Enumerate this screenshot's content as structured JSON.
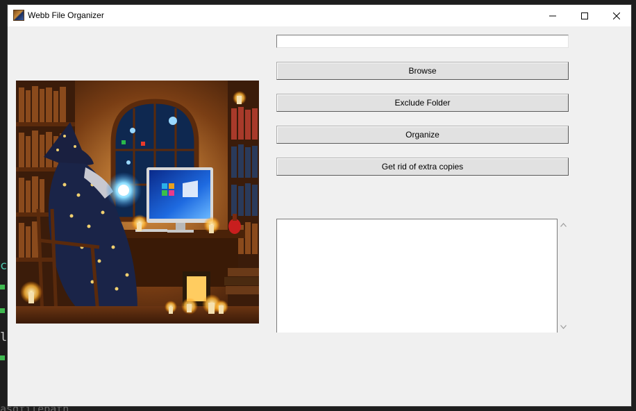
{
  "window": {
    "title": "Webb File Organizer",
    "controls": {
      "minimize": "minimize",
      "maximize": "maximize",
      "close": "close"
    }
  },
  "path_entry": {
    "value": "",
    "placeholder": ""
  },
  "buttons": {
    "browse": "Browse",
    "exclude_folder": "Exclude Folder",
    "organize": "Organize",
    "remove_duplicates": "Get rid of extra copies"
  },
  "log": {
    "text": ""
  },
  "image": {
    "subject": "wizard-at-computer-illustration"
  },
  "icons": {
    "app": "app-icon",
    "scroll_up": "chevron-up-icon",
    "scroll_down": "chevron-down-icon"
  },
  "colors": {
    "window_bg": "#f0f0f0",
    "button_bg": "#e1e1e1",
    "titlebar_bg": "#ffffff"
  }
}
